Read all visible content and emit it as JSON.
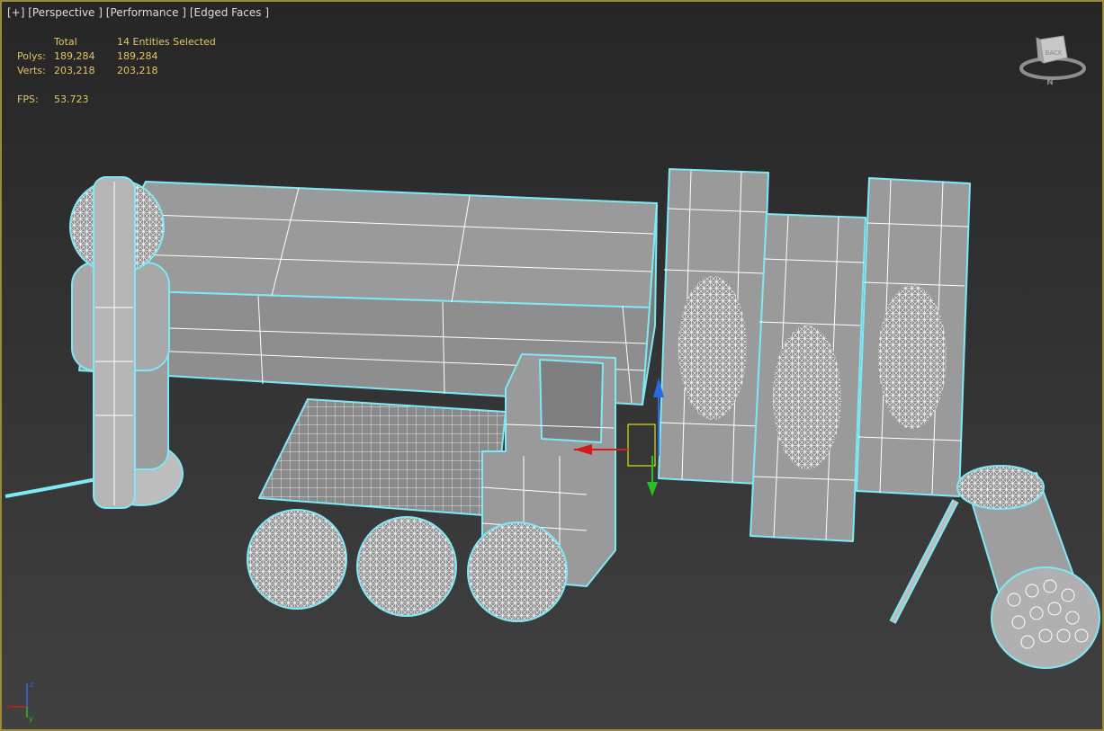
{
  "viewport": {
    "label_plus": "[+]",
    "label_view": "[Perspective ]",
    "label_shading": "[Performance ]",
    "label_edges": "[Edged Faces ]"
  },
  "stats": {
    "col_total": "Total",
    "col_selected": "14 Entities Selected",
    "polys_label": "Polys:",
    "polys_total": "189,284",
    "polys_selected": "189,284",
    "verts_label": "Verts:",
    "verts_total": "203,218",
    "verts_selected": "203,218",
    "fps_label": "FPS:",
    "fps_value": "53.723"
  },
  "viewcube": {
    "face_label": "BACK",
    "compass_label": "N"
  },
  "axis_tripod": {
    "x_label": "x",
    "y_label": "y",
    "z_label": "z"
  },
  "colors": {
    "viewport_border": "#9a8a3a",
    "stats_text": "#e2c46a",
    "selection_outline": "#7fe8f5",
    "wire": "#ffffff",
    "face": "#9a9a9a",
    "gizmo_x": "#d01c1c",
    "gizmo_y": "#28c028",
    "gizmo_z": "#2a6ae0"
  }
}
